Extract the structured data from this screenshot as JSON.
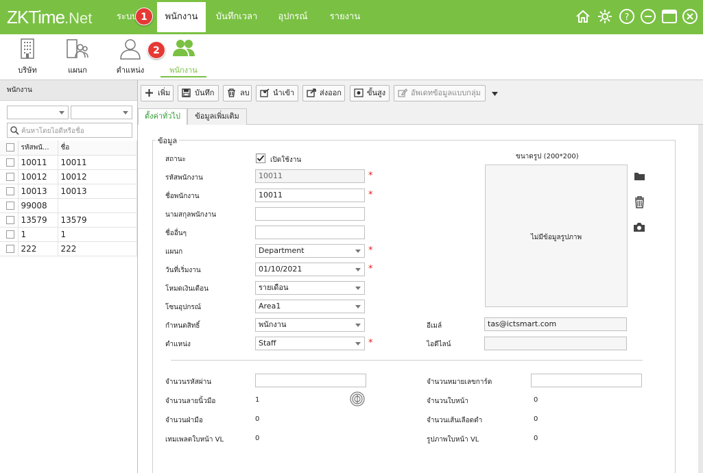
{
  "logo": {
    "zk": "ZKTime",
    "net": ".Net"
  },
  "menu": {
    "partial_tab": "ระบบ",
    "tabs": [
      "พนักงาน",
      "บันทึกเวลา",
      "อุปกรณ์",
      "รายงาน"
    ]
  },
  "badges": [
    "1",
    "2"
  ],
  "modules": [
    "บริษัท",
    "แผนก",
    "ตำแหน่ง",
    "พนักงาน"
  ],
  "left_panel": {
    "title": "พนักงาน",
    "search_placeholder": "ค้นหาโดยไอดีหรือชื่อ",
    "columns": [
      "รหัสพนั...",
      "ชื่อ"
    ],
    "rows": [
      {
        "id": "10011",
        "name": "10011"
      },
      {
        "id": "10012",
        "name": "10012"
      },
      {
        "id": "10013",
        "name": "10013"
      },
      {
        "id": "99008",
        "name": ""
      },
      {
        "id": "13579",
        "name": "13579"
      },
      {
        "id": "1",
        "name": "1"
      },
      {
        "id": "222",
        "name": "222"
      }
    ]
  },
  "toolbar": {
    "add": "เพิ่ม",
    "save": "บันทึก",
    "delete": "ลบ",
    "import": "นำเข้า",
    "export": "ส่งออก",
    "advanced": "ขั้นสูง",
    "batch_update": "อัพเดทข้อมูลแบบกลุ่ม"
  },
  "tabs": [
    "ตั้งค่าทั่วไป",
    "ข้อมูลเพิ่มเติม"
  ],
  "form": {
    "legend": "ข้อมูล",
    "status_label": "สถานะ",
    "status_checkbox": "เปิดใช้งาน",
    "emp_id_label": "รหัสพนักงาน",
    "emp_id": "10011",
    "name_label": "ชื่อพนักงาน",
    "name": "10011",
    "surname_label": "นามสกุลพนักงาน",
    "surname": "",
    "other_name_label": "ชื่ออื่นๆ",
    "other_name": "",
    "dept_label": "แผนก",
    "dept": "Department",
    "start_date_label": "วันที่เริ่มงาน",
    "start_date": "01/10/2021",
    "salary_mode_label": "โหมดเงินเดือน",
    "salary_mode": "รายเดือน",
    "device_zone_label": "โซนอุปกรณ์",
    "device_zone": "Area1",
    "privilege_label": "กำหนดสิทธิ์",
    "privilege": "พนักงาน",
    "position_label": "ตำแหน่ง",
    "position": "Staff",
    "photo_size_label": "ขนาดรูป (200*200)",
    "no_photo": "ไม่มีข้อมูลรูปภาพ",
    "email_label": "อีเมล์",
    "email": "tas@ictsmart.com",
    "line_label": "ไอดีไลน์",
    "line": ""
  },
  "stats": {
    "password_count_label": "จำนวนรหัสผ่าน",
    "fingerprint_count_label": "จำนวนลายนิ้วมือ",
    "fingerprint_count": "1",
    "palm_count_label": "จำนวนฝ่ามือ",
    "palm_count": "0",
    "face_vl_template_label": "เทมเพลตใบหน้า VL",
    "face_vl_template": "0",
    "card_number_label": "จำนวนหมายเลขการ์ด",
    "face_count_label": "จำนวนใบหน้า",
    "face_count": "0",
    "vein_count_label": "จำนวนเส้นเลือดดำ",
    "vein_count": "0",
    "face_vl_photo_label": "รูปภาพใบหน้า VL",
    "face_vl_photo": "0"
  },
  "colors": {
    "brand_green": "#7ac143",
    "required": "#e02020",
    "badge_red": "#e53935"
  }
}
